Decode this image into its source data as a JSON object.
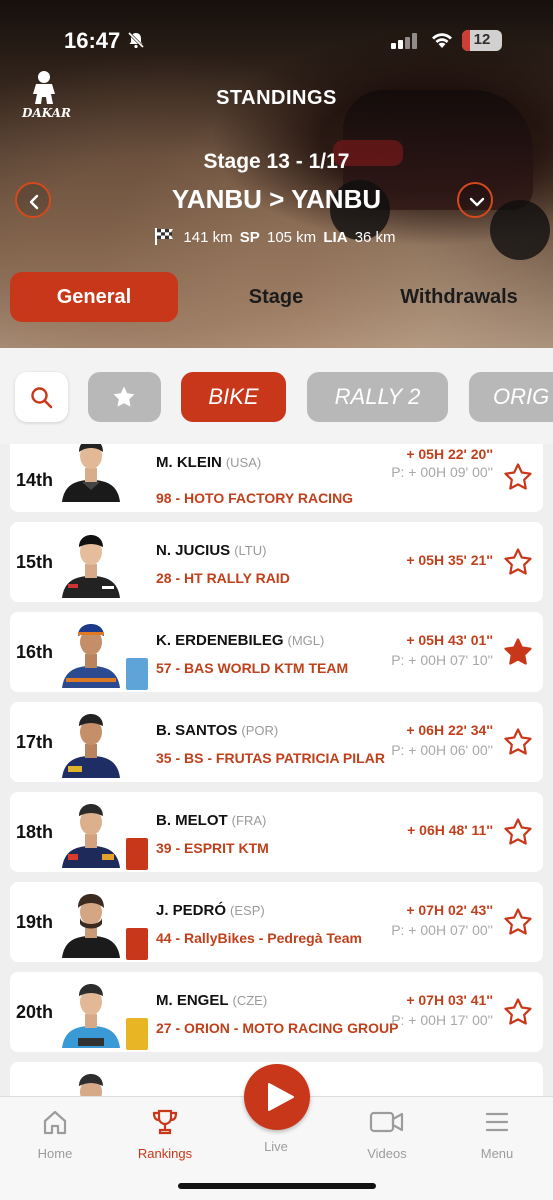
{
  "status": {
    "time": "16:47",
    "battery": "12"
  },
  "header": {
    "logo_text": "DAKAR",
    "title": "STANDINGS",
    "stage": "Stage 13 - 1/17",
    "route": "YANBU > YANBU",
    "distance_total": "141 km",
    "sp_label": "SP",
    "sp_value": "105 km",
    "lia_label": "LIA",
    "lia_value": "36 km"
  },
  "tabs": [
    "General",
    "Stage",
    "Withdrawals"
  ],
  "categories": [
    "BIKE",
    "RALLY 2",
    "ORIG"
  ],
  "rows": [
    {
      "pos": "14th",
      "name": "M. KLEIN",
      "nat": "(USA)",
      "team": "98 - HOTO FACTORY RACING",
      "gap": "+ 05H 22' 20''",
      "penalty": "P: + 00H 09' 00''",
      "fav": false,
      "badge": ""
    },
    {
      "pos": "15th",
      "name": "N. JUCIUS",
      "nat": "(LTU)",
      "team": "28 - HT RALLY RAID",
      "gap": "+ 05H 35' 21''",
      "penalty": "",
      "fav": false,
      "badge": ""
    },
    {
      "pos": "16th",
      "name": "K. ERDENEBILEG",
      "nat": "(MGL)",
      "team": "57 - BAS WORLD KTM TEAM",
      "gap": "+ 05H 43' 01''",
      "penalty": "P: + 00H 07' 10''",
      "fav": true,
      "badge": "blue"
    },
    {
      "pos": "17th",
      "name": "B. SANTOS",
      "nat": "(POR)",
      "team": "35 - BS - FRUTAS PATRICIA PILAR",
      "gap": "+ 06H 22' 34''",
      "penalty": "P: + 00H 06' 00''",
      "fav": false,
      "badge": ""
    },
    {
      "pos": "18th",
      "name": "B. MELOT",
      "nat": "(FRA)",
      "team": "39 - ESPRIT KTM",
      "gap": "+ 06H 48' 11''",
      "penalty": "",
      "fav": false,
      "badge": "red"
    },
    {
      "pos": "19th",
      "name": "J. PEDRÓ",
      "nat": "(ESP)",
      "team": "44 - RallyBikes - Pedregà Team",
      "gap": "+ 07H 02' 43''",
      "penalty": "P: + 00H 07' 00''",
      "fav": false,
      "badge": "red"
    },
    {
      "pos": "20th",
      "name": "M. ENGEL",
      "nat": "(CZE)",
      "team": "27 - ORION - MOTO RACING GROUP",
      "gap": "+ 07H 03' 41''",
      "penalty": "P: + 00H 17' 00''",
      "fav": false,
      "badge": "yellow"
    }
  ],
  "nav": [
    "Home",
    "Rankings",
    "Live",
    "Videos",
    "Menu"
  ],
  "colors": {
    "accent": "#c9371a",
    "team_text": "#c0401c"
  }
}
